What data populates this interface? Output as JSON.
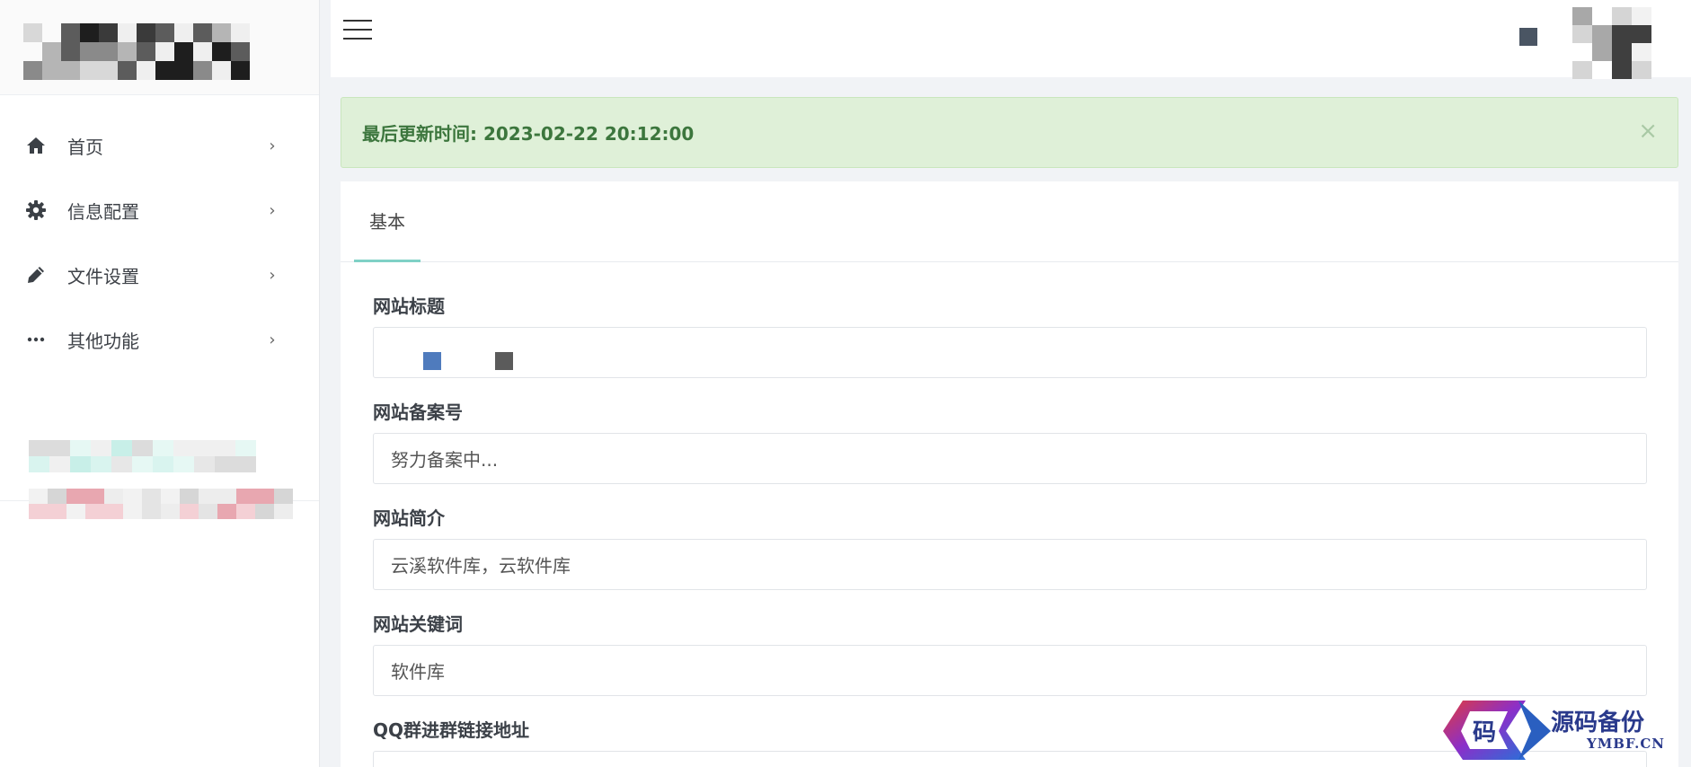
{
  "sidebar": {
    "items": [
      {
        "label": "首页",
        "icon": "home-icon"
      },
      {
        "label": "信息配置",
        "icon": "gear-icon"
      },
      {
        "label": "文件设置",
        "icon": "pencil-icon"
      },
      {
        "label": "其他功能",
        "icon": "more-icon"
      }
    ]
  },
  "alert": {
    "text": "最后更新时间: 2023-02-22 20:12:00",
    "close": "×"
  },
  "tabs": [
    {
      "label": "基本"
    }
  ],
  "form": {
    "site_title": {
      "label": "网站标题",
      "value": ""
    },
    "icp": {
      "label": "网站备案号",
      "value": "努力备案中..."
    },
    "description": {
      "label": "网站简介",
      "value": "云溪软件库，云软件库"
    },
    "keywords": {
      "label": "网站关键词",
      "value": "软件库"
    },
    "qq_group": {
      "label": "QQ群进群链接地址"
    }
  },
  "watermark": {
    "mark": "码",
    "cn": "源码备份",
    "en": "YMBF.CN"
  },
  "colors": {
    "accent": "#7fd1c6",
    "alert_bg": "#dff0d8",
    "alert_text": "#3c763d"
  }
}
